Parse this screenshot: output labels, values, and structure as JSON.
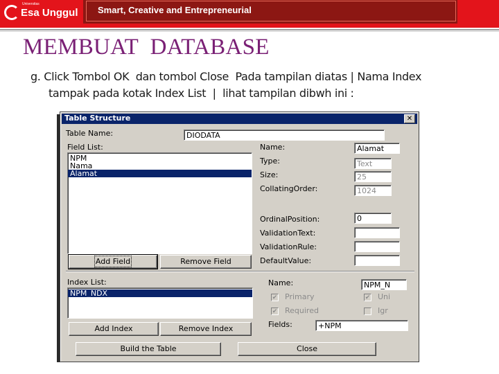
{
  "header": {
    "logo_small": "Universitas",
    "logo_text": "Esa Unggul",
    "tagline": "Smart, Creative and Entrepreneurial"
  },
  "slide": {
    "title": "MEMBUAT  DATABASE",
    "line1": "g. Click Tombol OK  dan tombol Close  Pada tampilan diatas | Nama Index",
    "line2": "tampak pada kotak Index List  |  lihat tampilan dibwh ini :"
  },
  "dialog": {
    "title": "Table Structure",
    "close_glyph": "✕",
    "table_name_label": "Table Name:",
    "table_name_value": "DIODATA",
    "field_list_label": "Field List:",
    "field_list": [
      "NPM",
      "Nama",
      "Alamat"
    ],
    "field_selected_index": 2,
    "props": {
      "name_label": "Name:",
      "name_value": "Alamat",
      "type_label": "Type:",
      "type_value": "Text",
      "size_label": "Size:",
      "size_value": "25",
      "collating_label": "CollatingOrder:",
      "collating_value": "1024",
      "ordinal_label": "OrdinalPosition:",
      "ordinal_value": "0",
      "validation_text_label": "ValidationText:",
      "validation_text_value": "",
      "validation_rule_label": "ValidationRule:",
      "validation_rule_value": "",
      "default_value_label": "DefaultValue:",
      "default_value_value": ""
    },
    "add_field_label": "Add Field",
    "remove_field_label": "Remove Field",
    "index_list_label": "Index List:",
    "index_list": [
      "NPM_NDX"
    ],
    "index": {
      "name_label": "Name:",
      "name_value": "NPM_N",
      "primary_label": "Primary",
      "unique_label": "Uni",
      "required_label": "Required",
      "ignore_label": "Igr",
      "fields_label": "Fields:",
      "fields_value": "+NPM"
    },
    "add_index_label": "Add Index",
    "remove_index_label": "Remove Index",
    "build_table_label": "Build the Table",
    "close_label": "Close"
  }
}
